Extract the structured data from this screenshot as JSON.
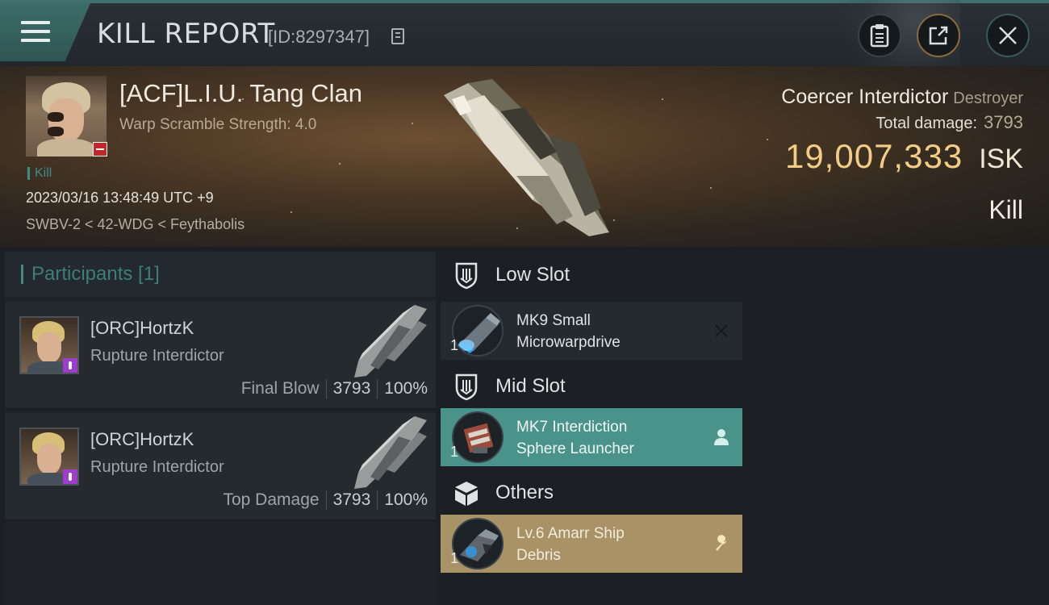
{
  "header": {
    "title": "KILL REPORT",
    "report_id": "[ID:8297347]",
    "icons": {
      "menu": "hamburger-menu-icon",
      "copy": "copy-icon",
      "clipboard": "clipboard-icon",
      "share": "share-icon",
      "close": "close-icon"
    }
  },
  "victim": {
    "name": "[ACF]L.I.U. Tang Clan",
    "warp_scramble": "Warp Scramble Strength: 4.0",
    "kill_tag": "Kill",
    "datetime": "2023/03/16 13:48:49 UTC +9",
    "location": "SWBV-2 < 42-WDG < Feythabolis",
    "ship_name": "Coercer Interdictor",
    "ship_class": "Destroyer",
    "total_damage_label": "Total damage:",
    "total_damage_value": "3793",
    "isk_amount": "19,007,333",
    "isk_currency": "ISK",
    "result": "Kill"
  },
  "participants": {
    "header": "Participants [1]",
    "items": [
      {
        "name": "[ORC]HortzK",
        "ship": "Rupture Interdictor",
        "role": "Final Blow",
        "damage": "3793",
        "percent": "100%"
      },
      {
        "name": "[ORC]HortzK",
        "ship": "Rupture Interdictor",
        "role": "Top Damage",
        "damage": "3793",
        "percent": "100%"
      }
    ]
  },
  "fitting": {
    "low_slot": {
      "label": "Low Slot",
      "module": {
        "qty": "1",
        "name_line1": "MK9 Small",
        "name_line2": "Microwarpdrive",
        "action_icon": "close-icon"
      }
    },
    "mid_slot": {
      "label": "Mid Slot",
      "module": {
        "qty": "1",
        "name_line1": "MK7 Interdiction",
        "name_line2": "Sphere Launcher",
        "action_icon": "person-icon"
      }
    },
    "others": {
      "label": "Others",
      "module": {
        "qty": "1",
        "name_line1": "Lv.6 Amarr Ship",
        "name_line2": "Debris",
        "action_icon": "wrench-icon"
      }
    }
  },
  "colors": {
    "accent_teal": "#3f8b86",
    "isk_gold": "#f3cd86",
    "mid_slot_bg": "#4a938b",
    "others_bg": "#a89266",
    "hostile_red": "#c0282c",
    "corp_purple": "#9d3ccd"
  }
}
